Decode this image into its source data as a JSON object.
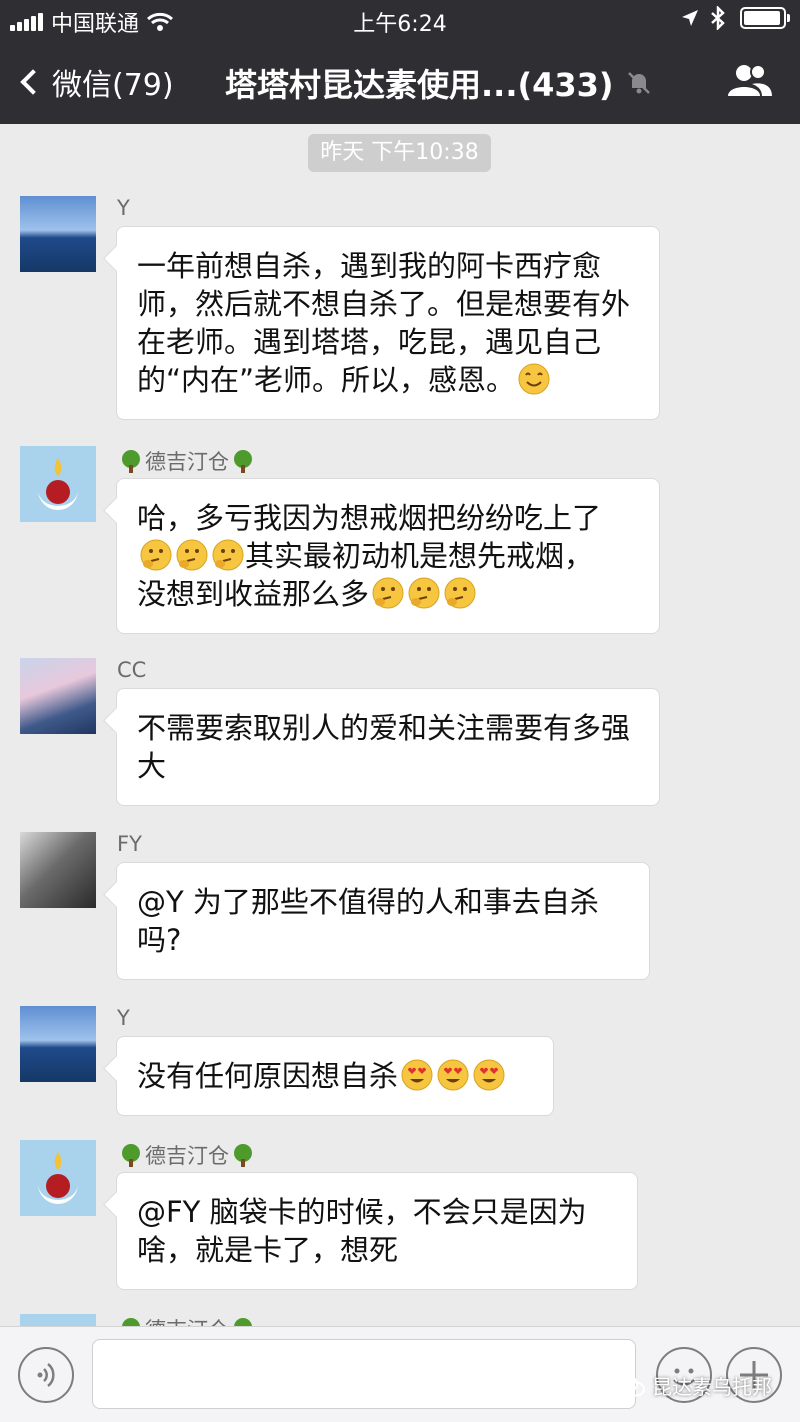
{
  "status_bar": {
    "carrier": "中国联通",
    "time": "上午6:24"
  },
  "nav": {
    "back_label": "微信(79)",
    "title": "塔塔村昆达素使用...(433)"
  },
  "chat": {
    "timestamp": "昨天 下午10:38",
    "messages": [
      {
        "sender": "Y",
        "text": "一年前想自杀，遇到我的阿卡西疗愈师，然后就不想自杀了。但是想要有外在老师。遇到塔塔，吃昆，遇见自己的“内在”老师。所以，感恩。",
        "emojis": [
          "smiling-face"
        ]
      },
      {
        "sender": "德吉汀仓",
        "line1": "哈，多亏我因为想戒烟把纷纷吃上了",
        "line2": "其实最初动机是想先戒烟，",
        "line3": "没想到收益那么多",
        "emojis": [
          "thinking-face",
          "thinking-face",
          "thinking-face",
          "thinking-face",
          "thinking-face",
          "thinking-face"
        ]
      },
      {
        "sender": "CC",
        "text": "不需要索取别人的爱和关注需要有多强大"
      },
      {
        "sender": "FY",
        "text": "@Y 为了那些不值得的人和事去自杀吗?"
      },
      {
        "sender": "Y",
        "text": "没有任何原因想自杀",
        "emojis": [
          "heart-eyes-face",
          "heart-eyes-face",
          "heart-eyes-face"
        ]
      },
      {
        "sender": "德吉汀仓",
        "text": "@FY 脑袋卡的时候，不会只是因为啥，就是卡了，想死"
      },
      {
        "sender": "德吉汀仓"
      }
    ]
  },
  "input_bar": {
    "watermark": "昆达素乌托邦"
  },
  "colors": {
    "header_bg": "#2e2e33",
    "chat_bg": "#ebebeb",
    "bubble_bg": "#ffffff"
  }
}
